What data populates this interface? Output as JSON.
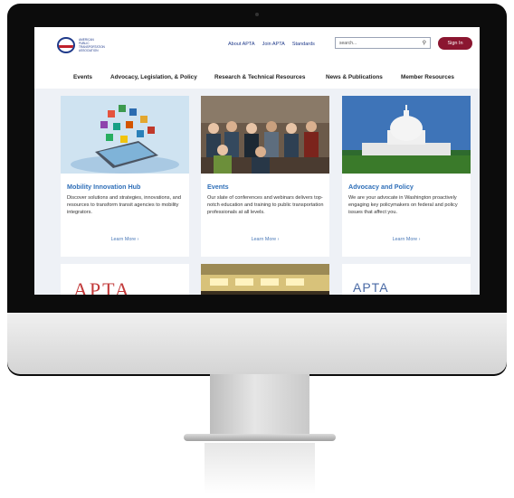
{
  "header": {
    "logo_mark": "APTA",
    "logo_lines": [
      "AMERICAN",
      "PUBLIC",
      "TRANSPORTATION",
      "ASSOCIATION"
    ],
    "top_links": [
      "About APTA",
      "Join APTA",
      "Standards"
    ],
    "search_placeholder": "search...",
    "sign_in": "Sign In"
  },
  "nav": {
    "items": [
      "Events",
      "Advocacy, Legislation, & Policy",
      "Research & Technical Resources",
      "News & Publications",
      "Member Resources"
    ]
  },
  "cards": [
    {
      "title": "Mobility Innovation Hub",
      "desc": "Discover solutions and strategies, innovations, and resources to transform transit agencies to mobility integrators.",
      "cta": "Learn More  ›"
    },
    {
      "title": "Events",
      "desc": "Our slate of conferences and webinars delivers top-notch education and training to public transportation professionals at all levels.",
      "cta": "Learn More  ›"
    },
    {
      "title": "Advocacy and Policy",
      "desc": "We are your advocate in Washington proactively engaging key policymakers on federal and policy issues that affect you.",
      "cta": "Learn More  ›"
    }
  ],
  "partial_cards": {
    "left_text": "APTA",
    "right_text": "APTA"
  },
  "colors": {
    "brand_blue": "#1f3a8a",
    "brand_red": "#8b1630",
    "link_blue": "#2f6fb8"
  }
}
